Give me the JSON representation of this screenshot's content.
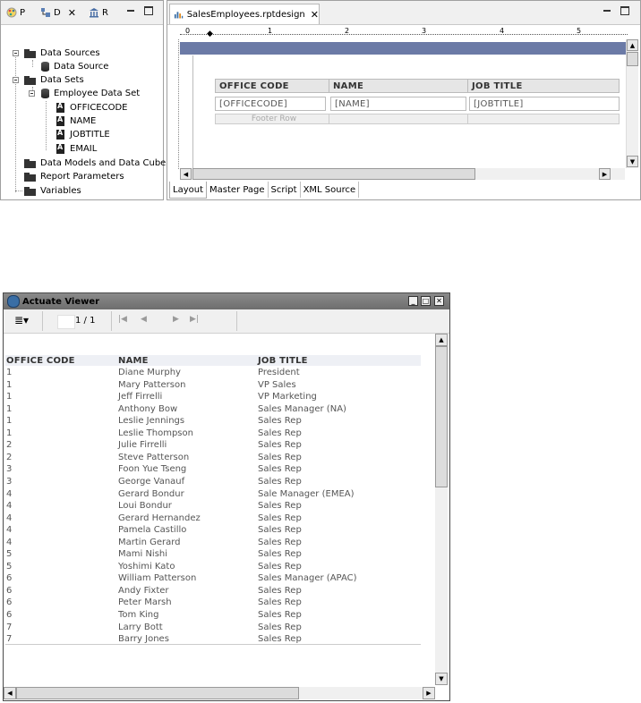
{
  "explorer": {
    "tabs": [
      {
        "label": "P"
      },
      {
        "label": "D"
      },
      {
        "label": "R"
      }
    ],
    "tree": {
      "data_sources": "Data Sources",
      "data_source": "Data Source",
      "data_sets": "Data Sets",
      "employee_data_set": "Employee Data Set",
      "fields": [
        "OFFICECODE",
        "NAME",
        "JOBTITLE",
        "EMAIL"
      ],
      "data_models": "Data Models and Data Cubes",
      "report_parameters": "Report Parameters",
      "variables": "Variables"
    }
  },
  "editor": {
    "tab_label": "SalesEmployees.rptdesign",
    "ruler_marks": [
      "0",
      "1",
      "2",
      "3",
      "4",
      "5"
    ],
    "table": {
      "headers": [
        "OFFICE CODE",
        "NAME",
        "JOB TITLE"
      ],
      "details": [
        "[OFFICECODE]",
        "[NAME]",
        "[JOBTITLE]"
      ],
      "footer": "Footer Row"
    },
    "bottom_tabs": [
      "Layout",
      "Master Page",
      "Script",
      "XML Source"
    ],
    "active_bottom_tab": "Layout"
  },
  "viewer": {
    "title": "Actuate Viewer",
    "page_indicator": "1 / 1",
    "columns": [
      "OFFICE CODE",
      "NAME",
      "JOB TITLE"
    ],
    "rows": [
      [
        "1",
        "Diane Murphy",
        "President"
      ],
      [
        "1",
        "Mary Patterson",
        "VP Sales"
      ],
      [
        "1",
        "Jeff Firrelli",
        "VP Marketing"
      ],
      [
        "1",
        "Anthony Bow",
        "Sales Manager (NA)"
      ],
      [
        "1",
        "Leslie Jennings",
        "Sales Rep"
      ],
      [
        "1",
        "Leslie Thompson",
        "Sales Rep"
      ],
      [
        "2",
        "Julie Firrelli",
        "Sales Rep"
      ],
      [
        "2",
        "Steve Patterson",
        "Sales Rep"
      ],
      [
        "3",
        "Foon Yue Tseng",
        "Sales Rep"
      ],
      [
        "3",
        "George Vanauf",
        "Sales Rep"
      ],
      [
        "4",
        "Gerard Bondur",
        "Sale Manager (EMEA)"
      ],
      [
        "4",
        "Loui Bondur",
        "Sales Rep"
      ],
      [
        "4",
        "Gerard Hernandez",
        "Sales Rep"
      ],
      [
        "4",
        "Pamela Castillo",
        "Sales Rep"
      ],
      [
        "4",
        "Martin Gerard",
        "Sales Rep"
      ],
      [
        "5",
        "Mami Nishi",
        "Sales Rep"
      ],
      [
        "5",
        "Yoshimi Kato",
        "Sales Rep"
      ],
      [
        "6",
        "William Patterson",
        "Sales Manager (APAC)"
      ],
      [
        "6",
        "Andy Fixter",
        "Sales Rep"
      ],
      [
        "6",
        "Peter Marsh",
        "Sales Rep"
      ],
      [
        "6",
        "Tom King",
        "Sales Rep"
      ],
      [
        "7",
        "Larry Bott",
        "Sales Rep"
      ],
      [
        "7",
        "Barry Jones",
        "Sales Rep"
      ]
    ]
  }
}
